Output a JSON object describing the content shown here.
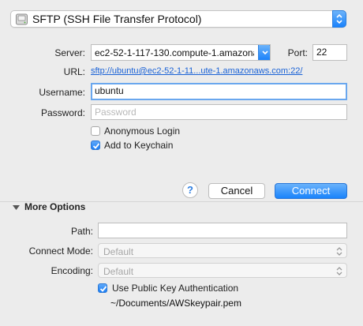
{
  "protocol": {
    "selected": "SFTP (SSH File Transfer Protocol)"
  },
  "server": {
    "label": "Server:",
    "value": "ec2-52-1-117-130.compute-1.amazona"
  },
  "port": {
    "label": "Port:",
    "value": "22"
  },
  "url": {
    "label": "URL:",
    "value": "sftp://ubuntu@ec2-52-1-11...ute-1.amazonaws.com:22/"
  },
  "username": {
    "label": "Username:",
    "value": "ubuntu"
  },
  "password": {
    "label": "Password:",
    "placeholder": "Password"
  },
  "options": {
    "anonymous": {
      "label": "Anonymous Login",
      "checked": false
    },
    "keychain": {
      "label": "Add to Keychain",
      "checked": true
    }
  },
  "actions": {
    "help": "?",
    "cancel": "Cancel",
    "connect": "Connect"
  },
  "more_options": {
    "title": "More Options",
    "path_label": "Path:",
    "connect_mode_label": "Connect Mode:",
    "connect_mode_value": "Default",
    "encoding_label": "Encoding:",
    "encoding_value": "Default",
    "public_key": {
      "label": "Use Public Key Authentication",
      "checked": true
    },
    "key_file": "~/Documents/AWSkeypair.pem"
  },
  "colors": {
    "accent": "#1a83fb",
    "link": "#1a62d6"
  },
  "icons": [
    "disk-icon",
    "chevron-updown-icon",
    "checkmark-icon",
    "disclosure-triangle-icon"
  ]
}
